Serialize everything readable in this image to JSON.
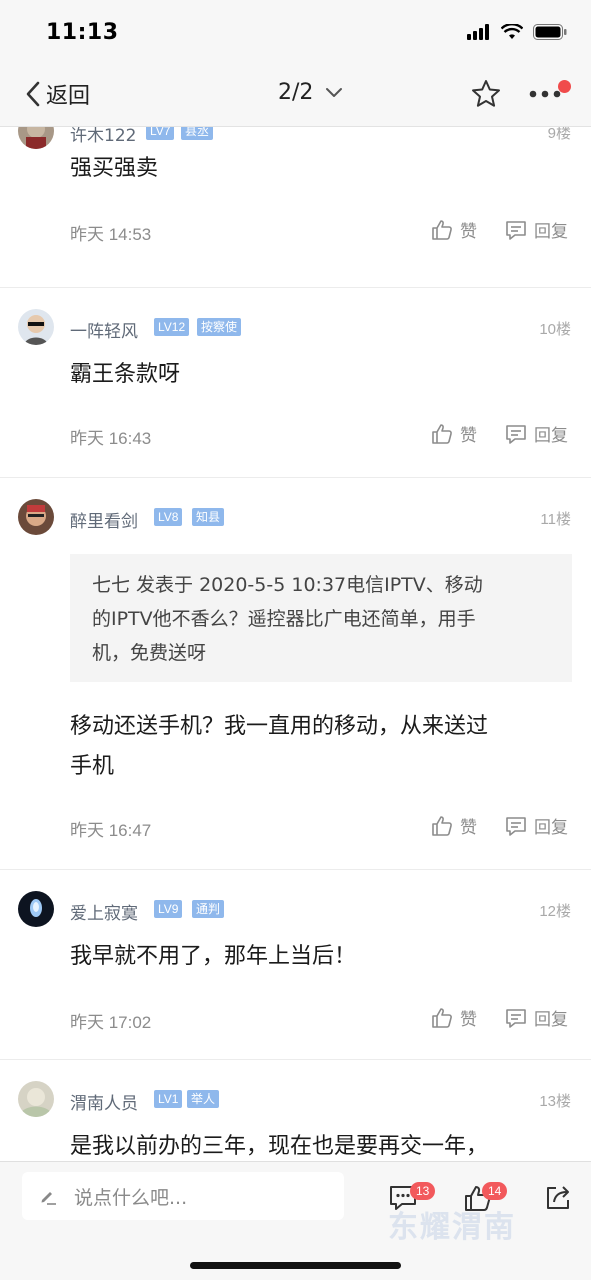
{
  "status_bar": {
    "time": "11:13"
  },
  "nav": {
    "back_label": "返回",
    "page": "2/2"
  },
  "posts": [
    {
      "username": "许木122",
      "level": "LV7",
      "title": "县丞",
      "floor": "9楼",
      "content": "强买强卖",
      "time": "昨天 14:53",
      "like_label": "赞",
      "reply_label": "回复"
    },
    {
      "username": "一阵轻风",
      "level": "LV12",
      "title": "按察使",
      "floor": "10楼",
      "content": "霸王条款呀",
      "time": "昨天 16:43",
      "like_label": "赞",
      "reply_label": "回复"
    },
    {
      "username": "醉里看剑",
      "level": "LV8",
      "title": "知县",
      "floor": "11楼",
      "quote_line1": "七七 发表于 2020-5-5 10:37电信IPTV、移动",
      "quote_line2": "的IPTV他不香么？遥控器比广电还简单，用手",
      "quote_line3": "机，免费送呀",
      "content_line1": "移动还送手机？我一直用的移动，从来送过",
      "content_line2": "手机",
      "time": "昨天 16:47",
      "like_label": "赞",
      "reply_label": "回复"
    },
    {
      "username": "爱上寂寞",
      "level": "LV9",
      "title": "通判",
      "floor": "12楼",
      "content": "我早就不用了，那年上当后！",
      "time": "昨天 17:02",
      "like_label": "赞",
      "reply_label": "回复"
    },
    {
      "username": "渭南人员",
      "level": "LV1",
      "title": "举人",
      "floor": "13楼",
      "content": "是我以前办的三年，现在也是要再交一年，"
    }
  ],
  "bottom_bar": {
    "comment_placeholder": "说点什么吧...",
    "comment_count": "13",
    "like_count": "14",
    "watermark": "东耀渭南"
  },
  "colors": {
    "badge": "#8fb8ec",
    "count_badge": "#f2595c",
    "notify_dot": "#f04b4b"
  }
}
